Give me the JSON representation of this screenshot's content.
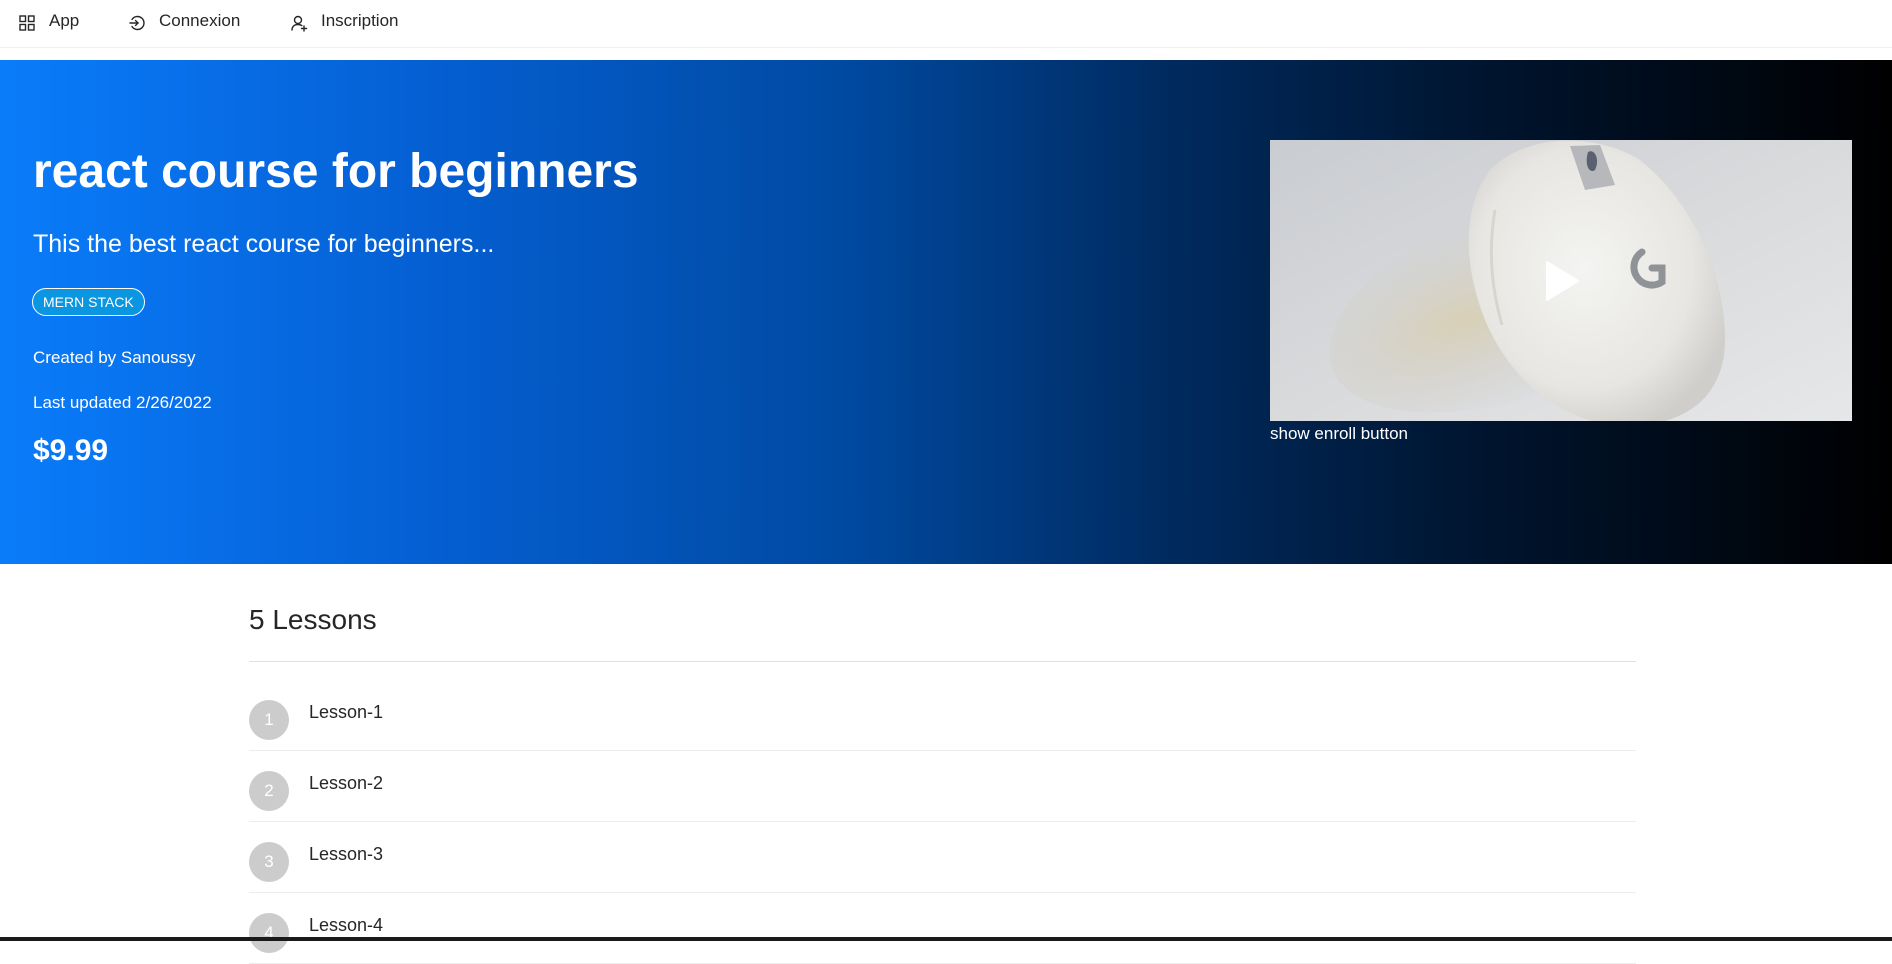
{
  "nav": {
    "items": [
      {
        "label": "App",
        "icon": "apps-grid-icon"
      },
      {
        "label": "Connexion",
        "icon": "login-icon"
      },
      {
        "label": "Inscription",
        "icon": "user-add-icon"
      }
    ]
  },
  "course": {
    "title": "react course for beginners",
    "description": "This the best react course for beginners...",
    "category": "MERN STACK",
    "author_line": "Created by Sanoussy",
    "updated_line": "Last updated 2/26/2022",
    "price": "$9.99",
    "preview_icon": "play-icon",
    "enroll_link": "show enroll button"
  },
  "lessons": {
    "heading": "5 Lessons",
    "items": [
      {
        "number": "1",
        "title": "Lesson-1"
      },
      {
        "number": "2",
        "title": "Lesson-2"
      },
      {
        "number": "3",
        "title": "Lesson-3"
      },
      {
        "number": "4",
        "title": "Lesson-4"
      }
    ]
  },
  "colors": {
    "hero_gradient_start": "#0a7cfa",
    "hero_gradient_end": "#000000",
    "tag_background": "#0a96e0",
    "lesson_badge": "#cccccc"
  }
}
